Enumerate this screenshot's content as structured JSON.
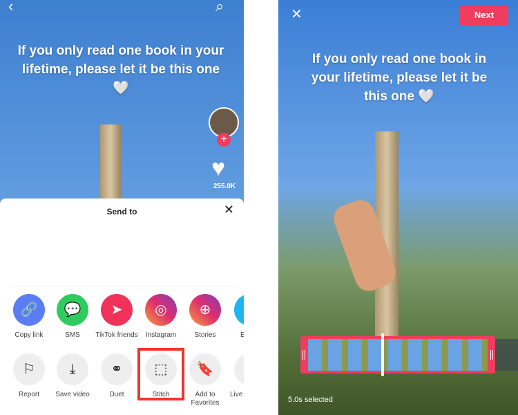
{
  "left": {
    "caption": "If you only read one book in your lifetime, please let it be this one 🤍",
    "like_count": "255.0K",
    "sheet": {
      "title": "Send to",
      "share_items": [
        {
          "label": "Copy link",
          "icon": "link-icon",
          "color": "#5b7cf5"
        },
        {
          "label": "SMS",
          "icon": "message-icon",
          "color": "#2fcb5f"
        },
        {
          "label": "TikTok friends",
          "icon": "send-icon",
          "color": "#f0325a"
        },
        {
          "label": "Instagram",
          "icon": "instagram-icon",
          "color": "#c13584"
        },
        {
          "label": "Stories",
          "icon": "stories-icon",
          "color": "#e1306c"
        },
        {
          "label": "E",
          "icon": "app-icon",
          "color": "#1fb6f0"
        }
      ],
      "action_items": [
        {
          "label": "Report",
          "icon": "flag-icon"
        },
        {
          "label": "Save video",
          "icon": "download-icon"
        },
        {
          "label": "Duet",
          "icon": "duet-icon"
        },
        {
          "label": "Stitch",
          "icon": "stitch-icon"
        },
        {
          "label": "Add to Favorites",
          "icon": "bookmark-icon"
        },
        {
          "label": "Live",
          "icon": "live-icon"
        }
      ]
    },
    "highlight_color": "#f2352b"
  },
  "right": {
    "caption": "If you only read one book in your lifetime, please let it be this one 🤍",
    "next_label": "Next",
    "selected_text": "5.0s selected",
    "accent": "#f03c5e"
  }
}
